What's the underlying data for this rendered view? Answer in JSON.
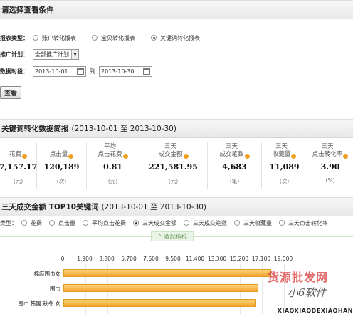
{
  "conditions": {
    "title": "请选择查看条件",
    "report_type_label": "报表类型：",
    "report_types": [
      {
        "label": "账户转化报表",
        "selected": false
      },
      {
        "label": "宝贝转化报表",
        "selected": false
      },
      {
        "label": "关键词转化报表",
        "selected": true
      }
    ],
    "plan_label": "推广计划：",
    "plan_value": "全部推广计划",
    "period_label": "数据时段：",
    "date_from": "2013-10-01",
    "date_sep": "到",
    "date_to": "2013-10-30",
    "query_button": "查看"
  },
  "summary": {
    "title": "关键词转化数据简报",
    "dates": "(2013-10-01 至 2013-10-30)",
    "metrics": [
      {
        "label": "花费",
        "value": "7,157.17",
        "unit": "(元)"
      },
      {
        "label": "点击量",
        "value": "120,189",
        "unit": "(次)"
      },
      {
        "label": "平均\n点击花费",
        "value": "0.81",
        "unit": "(元)"
      },
      {
        "label": "三天\n成交金额",
        "value": "221,581.95",
        "unit": "(元)"
      },
      {
        "label": "三天\n成交笔数",
        "value": "4,683",
        "unit": "(笔)"
      },
      {
        "label": "三天\n收藏量",
        "value": "11,089",
        "unit": "(次)"
      },
      {
        "label": "三天\n点击转化率",
        "value": "3.90",
        "unit": "(%)"
      }
    ]
  },
  "top10": {
    "title": "三天成交金额 TOP10关键词",
    "dates": "(2013-10-01 至 2013-10-30)",
    "type_label": "类型：",
    "types": [
      {
        "label": "花费",
        "selected": false
      },
      {
        "label": "点击量",
        "selected": false
      },
      {
        "label": "平均点击花费",
        "selected": false
      },
      {
        "label": "三天成交金额",
        "selected": true
      },
      {
        "label": "三天成交笔数",
        "selected": false
      },
      {
        "label": "三天收藏量",
        "selected": false
      },
      {
        "label": "三天点击转化率",
        "selected": false
      }
    ],
    "collapse_label": "收起指标"
  },
  "chart_data": {
    "type": "bar",
    "orientation": "horizontal",
    "x_ticks": [
      "0",
      "1,900",
      "3,800",
      "5,700",
      "7,600",
      "9,500",
      "11,400",
      "13,300",
      "15,200",
      "17,100",
      "19,000"
    ],
    "xlim": [
      0,
      19000
    ],
    "categories": [
      "棉麻围巾女",
      "围巾",
      "围巾 韩国 秋冬 女"
    ],
    "values": [
      17900,
      16800,
      16600
    ],
    "bar_color": "#f3a52a",
    "grid": true
  },
  "watermark": {
    "title": "货源批发网",
    "handwriting": "小6软件",
    "site": "XIAOXIAODEXIAOHAN"
  },
  "colors": {
    "question_icon": "#f0a020",
    "collapse_tab": "#eaf4e6",
    "watermark": "#d53e3e"
  }
}
